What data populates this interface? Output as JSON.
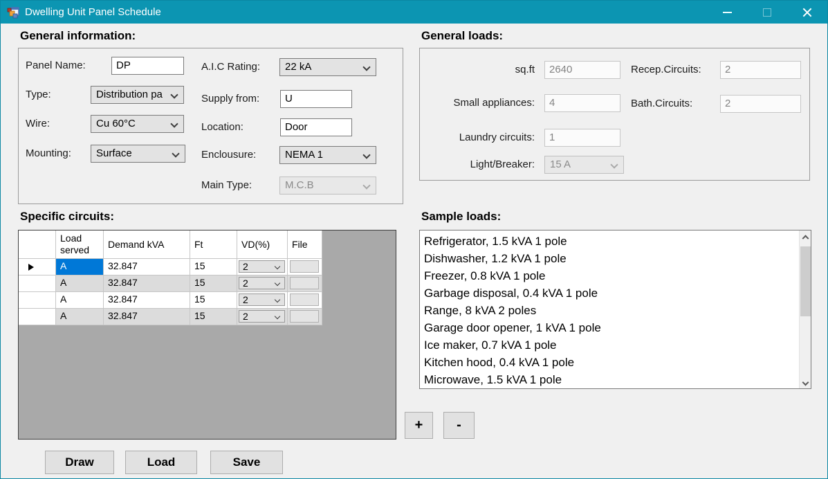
{
  "window": {
    "title": "Dwelling Unit Panel Schedule"
  },
  "accent_colors": {
    "titlebar": "#0c95b2",
    "selection": "#0078d7",
    "form_background": "#f0f0f0"
  },
  "general_information": {
    "heading": "General information:",
    "panel_name": {
      "label": "Panel Name:",
      "value": "DP"
    },
    "type": {
      "label": "Type:",
      "value": "Distribution pa"
    },
    "wire": {
      "label": "Wire:",
      "value": "Cu 60°C"
    },
    "mounting": {
      "label": "Mounting:",
      "value": "Surface"
    },
    "aic_rating": {
      "label": "A.I.C Rating:",
      "value": "22 kA"
    },
    "supply_from": {
      "label": "Supply from:",
      "value": "U"
    },
    "location": {
      "label": "Location:",
      "value": "Door"
    },
    "enclousure": {
      "label": "Enclousure:",
      "value": "NEMA 1"
    },
    "main_type": {
      "label": "Main Type:",
      "value": "M.C.B"
    }
  },
  "general_loads": {
    "heading": "General loads:",
    "sqft": {
      "label": "sq.ft",
      "value": "2640"
    },
    "small_appliances": {
      "label": "Small appliances:",
      "value": "4"
    },
    "laundry_circuits": {
      "label": "Laundry circuits:",
      "value": "1"
    },
    "light_breaker": {
      "label": "Light/Breaker:",
      "value": "15 A"
    },
    "recep_circuits": {
      "label": "Recep.Circuits:",
      "value": "2"
    },
    "bath_circuits": {
      "label": "Bath.Circuits:",
      "value": "2"
    }
  },
  "specific_circuits": {
    "heading": "Specific circuits:",
    "columns": [
      "Load served",
      "Demand kVA",
      "Ft",
      "VD(%)",
      "File"
    ],
    "rows": [
      {
        "load_served": "A",
        "demand_kva": "32.847",
        "ft": "15",
        "vd": "2"
      },
      {
        "load_served": "A",
        "demand_kva": "32.847",
        "ft": "15",
        "vd": "2"
      },
      {
        "load_served": "A",
        "demand_kva": "32.847",
        "ft": "15",
        "vd": "2"
      },
      {
        "load_served": "A",
        "demand_kva": "32.847",
        "ft": "15",
        "vd": "2"
      }
    ]
  },
  "sample_loads": {
    "heading": "Sample loads:",
    "items": [
      "Refrigerator, 1.5 kVA 1 pole",
      "Dishwasher, 1.2 kVA 1 pole",
      "Freezer, 0.8 kVA 1 pole",
      "Garbage disposal, 0.4 kVA 1 pole",
      "Range, 8 kVA 2 poles",
      "Garage door opener, 1 kVA 1 pole",
      "Ice maker, 0.7 kVA 1 pole",
      "Kitchen hood, 0.4 kVA 1 pole",
      "Microwave, 1.5 kVA 1 pole"
    ]
  },
  "actions": {
    "add": "+",
    "remove": "-",
    "draw": "Draw",
    "load": "Load",
    "save": "Save"
  }
}
